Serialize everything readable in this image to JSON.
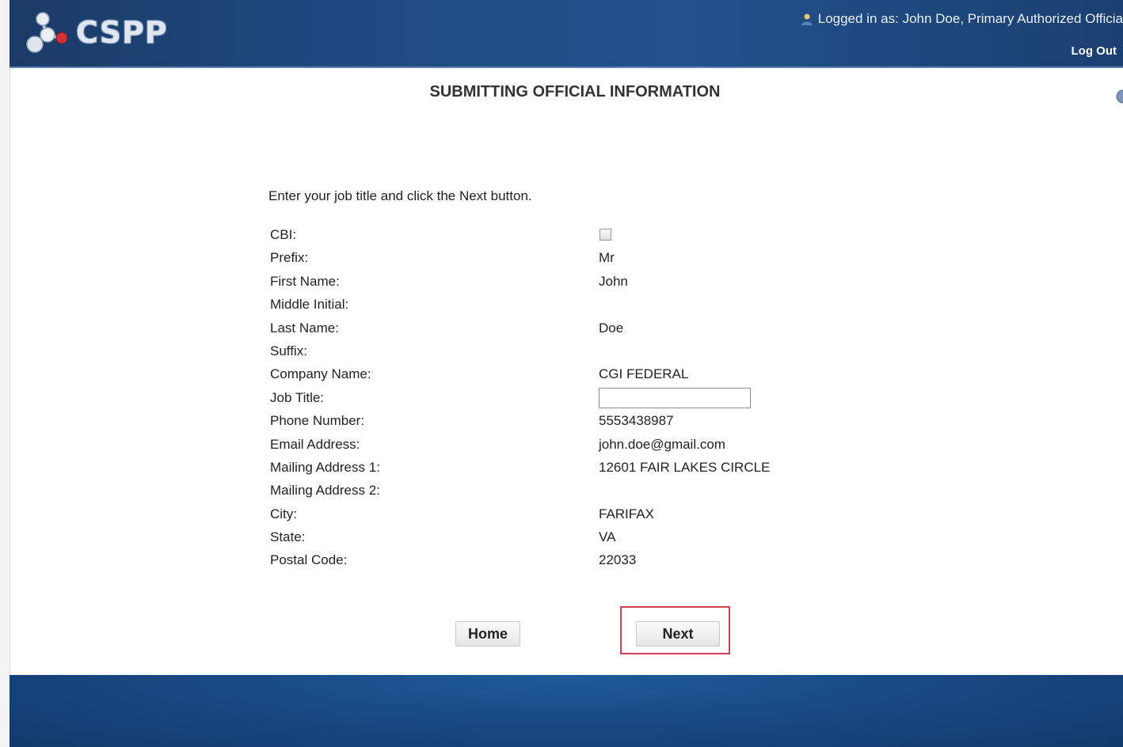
{
  "header": {
    "logo_text": "CSPP",
    "user_prefix": "Logged in as:",
    "user_name": "John Doe, Primary Authorized Officia",
    "logout_label": "Log Out"
  },
  "page": {
    "title": "SUBMITTING OFFICIAL INFORMATION",
    "instructions": "Enter your job title and click the Next button."
  },
  "form": {
    "cbi_label": "CBI:",
    "cbi_checked": false,
    "prefix_label": "Prefix:",
    "prefix_value": "Mr",
    "first_name_label": "First Name:",
    "first_name_value": "John",
    "middle_initial_label": "Middle Initial:",
    "middle_initial_value": "",
    "last_name_label": "Last Name:",
    "last_name_value": "Doe",
    "suffix_label": "Suffix:",
    "suffix_value": "",
    "company_label": "Company Name:",
    "company_value": "CGI FEDERAL",
    "job_title_label": "Job Title:",
    "job_title_value": "",
    "phone_label": "Phone Number:",
    "phone_value": "5553438987",
    "email_label": "Email Address:",
    "email_value": "john.doe@gmail.com",
    "mailing1_label": "Mailing Address 1:",
    "mailing1_value": "12601 FAIR LAKES CIRCLE",
    "mailing2_label": "Mailing Address 2:",
    "mailing2_value": "",
    "city_label": "City:",
    "city_value": "FARIFAX",
    "state_label": "State:",
    "state_value": "VA",
    "postal_label": "Postal Code:",
    "postal_value": "22033"
  },
  "buttons": {
    "home_label": "Home",
    "next_label": "Next"
  },
  "colors": {
    "header_bg": "#1f4a80",
    "highlight": "#d04050",
    "footer_bg": "#184a84"
  }
}
